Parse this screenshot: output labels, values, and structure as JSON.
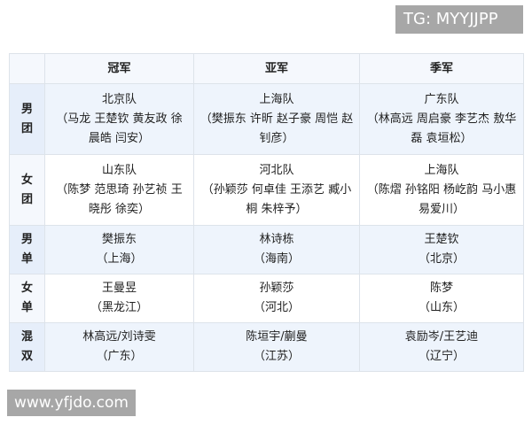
{
  "watermarks": {
    "top": "TG: MYYJJPP",
    "bottom": "www.yfjdo.com"
  },
  "table": {
    "headers": [
      "冠军",
      "亚军",
      "季军"
    ],
    "rows": [
      {
        "event": "男团",
        "cells": [
          {
            "main": "北京队",
            "sub": "（马龙 王楚钦 黄友政 徐晨皓 闫安）"
          },
          {
            "main": "上海队",
            "sub": "（樊振东 许昕 赵子豪 周恺 赵钊彦）"
          },
          {
            "main": "广东队",
            "sub": "（林高远 周启豪 李艺杰 敖华磊 袁垣松）"
          }
        ]
      },
      {
        "event": "女团",
        "cells": [
          {
            "main": "山东队",
            "sub": "（陈梦 范思琦 孙艺祯 王晓彤 徐奕）"
          },
          {
            "main": "河北队",
            "sub": "（孙颖莎 何卓佳 王添艺 臧小桐 朱梓予）"
          },
          {
            "main": "上海队",
            "sub": "（陈熠 孙铭阳 杨屹韵 马小惠 易爱川）"
          }
        ]
      },
      {
        "event": "男单",
        "cells": [
          {
            "main": "樊振东",
            "sub": "（上海）"
          },
          {
            "main": "林诗栋",
            "sub": "（海南）"
          },
          {
            "main": "王楚钦",
            "sub": "（北京）"
          }
        ]
      },
      {
        "event": "女单",
        "cells": [
          {
            "main": "王曼昱",
            "sub": "（黑龙江）"
          },
          {
            "main": "孙颖莎",
            "sub": "（河北）"
          },
          {
            "main": "陈梦",
            "sub": "（山东）"
          }
        ]
      },
      {
        "event": "混双",
        "cells": [
          {
            "main": "林高远/刘诗雯",
            "sub": "（广东）"
          },
          {
            "main": "陈垣宇/蒯曼",
            "sub": "（江苏）"
          },
          {
            "main": "袁励岑/王艺迪",
            "sub": "（辽宁）"
          }
        ]
      }
    ]
  }
}
